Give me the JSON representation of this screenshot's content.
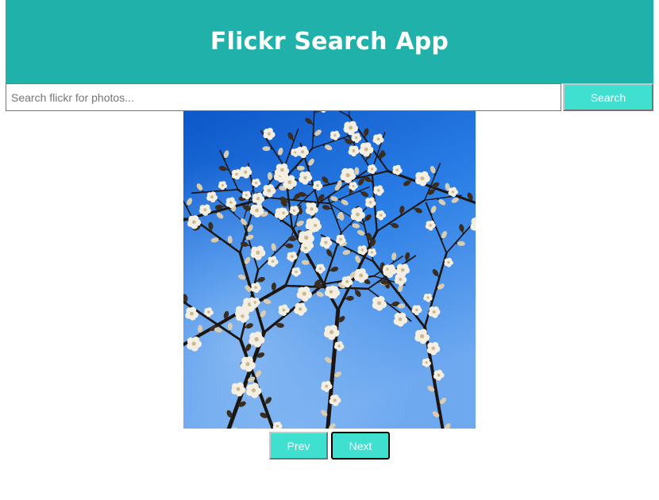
{
  "header": {
    "title": "Flickr Search App"
  },
  "search": {
    "placeholder": "Search flickr for photos...",
    "value": "",
    "button_label": "Search"
  },
  "photo": {
    "subject": "cherry blossom branches against blue sky"
  },
  "pagination": {
    "prev_label": "Prev",
    "next_label": "Next"
  },
  "colors": {
    "header_bg": "#20b2aa",
    "button_bg": "#40e0d0",
    "text_on_accent": "#ffffff",
    "sky": "#1f6fd6"
  },
  "icons": {
    "photo": "cherry-blossom-photo"
  }
}
